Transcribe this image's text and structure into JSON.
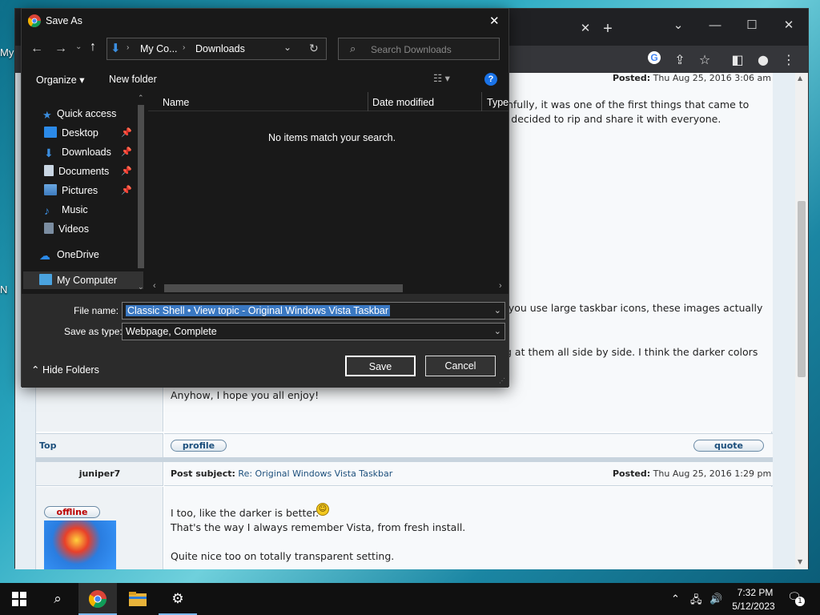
{
  "desktop": {
    "icon_fragments": [
      "My",
      "N"
    ]
  },
  "browser": {
    "window_controls": {
      "minimize": "—",
      "maximize": "☐",
      "close": "✕"
    },
    "tab_close": "✕",
    "new_tab": "+",
    "toolbar_icons": [
      "google-icon",
      "share-icon",
      "star-icon",
      "sidebar-icon",
      "profile-icon",
      "menu-icon"
    ]
  },
  "forum": {
    "post1": {
      "posted_label": "Posted:",
      "posted_date": "Thu Aug 25, 2016 3:06 am",
      "line1": "ruthfully, it was one of the first things that came to",
      "line2": "o I decided to rip and share it with everyone.",
      "line3": "if you use large taskbar icons, these images actually",
      "line4": "g at them all side by side. I think the darker colors",
      "line5": "Anyhow, I hope you all enjoy!",
      "top_link": "Top",
      "profile_btn": "profile",
      "quote_btn": "quote"
    },
    "post2": {
      "author": "juniper7",
      "subject_label": "Post subject:",
      "subject": "Re: Original Windows Vista Taskbar",
      "posted_label": "Posted:",
      "posted_date": "Thu Aug 25, 2016 1:29 pm",
      "status": "offline",
      "line1": "I too, like the darker is better.",
      "line2": "That's the way I always remember Vista, from fresh install.",
      "line3": "Quite nice too on totally transparent setting."
    }
  },
  "dialog": {
    "title": "Save As",
    "close": "✕",
    "breadcrumb": [
      "My Co...",
      "Downloads"
    ],
    "search_placeholder": "Search Downloads",
    "organize": "Organize",
    "new_folder": "New folder",
    "help": "?",
    "tree": {
      "quick_access": "Quick access",
      "items": [
        "Desktop",
        "Downloads",
        "Documents",
        "Pictures",
        "Music",
        "Videos"
      ],
      "onedrive": "OneDrive",
      "my_computer": "My Computer"
    },
    "columns": [
      "Name",
      "Date modified",
      "Type"
    ],
    "empty_message": "No items match your search.",
    "file_name_label": "File name:",
    "file_name_value": "Classic Shell • View topic - Original Windows Vista Taskbar",
    "save_type_label": "Save as type:",
    "save_type_value": "Webpage, Complete",
    "hide_folders": "Hide Folders",
    "save": "Save",
    "cancel": "Cancel"
  },
  "taskbar": {
    "time": "7:32 PM",
    "date": "5/12/2023",
    "notification_count": "1"
  }
}
